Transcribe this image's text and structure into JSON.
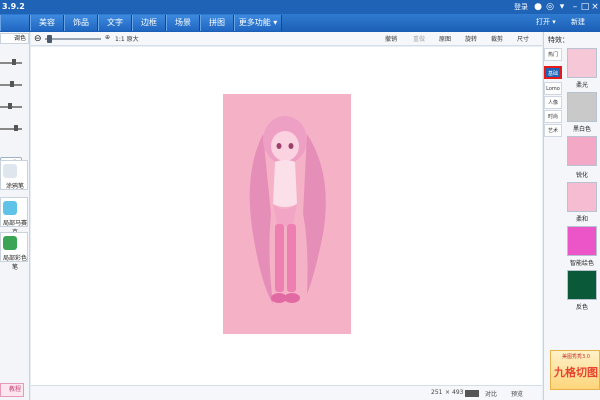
{
  "titlebar": {
    "version": "3.9.2",
    "login": "登录"
  },
  "nav": {
    "tabs": [
      "美容",
      "饰品",
      "文字",
      "边框",
      "场景",
      "拼图",
      "更多功能 ▾"
    ],
    "open": "打开 ▾",
    "new": "新建"
  },
  "left": {
    "tab": "调色",
    "apply": "化",
    "tools": [
      "涂鸦笔",
      "局部马赛克",
      "局部彩色笔"
    ],
    "bottom": "教程"
  },
  "toolbar": {
    "zoom_label": "1:1 原大",
    "actions": [
      "撤销",
      "重做",
      "原图",
      "旋转",
      "裁剪",
      "尺寸"
    ]
  },
  "status": {
    "width": "251",
    "sep": "×",
    "height": "493",
    "compare": "对比",
    "preview": "预览"
  },
  "right": {
    "title": "特效：",
    "categories": [
      "热门",
      "基础",
      "Lomo",
      "人像",
      "时尚",
      "艺术"
    ],
    "effects": [
      "柔光",
      "黑白色",
      "锐化",
      "柔和",
      "智能绘色",
      "反色"
    ],
    "ad_top": "美图秀秀3.0",
    "ad_main": "九格切图"
  },
  "colors": {
    "brand": "#1f63b7",
    "accent_red": "#e51a1a",
    "photo_bg": "#f5b2c6"
  }
}
